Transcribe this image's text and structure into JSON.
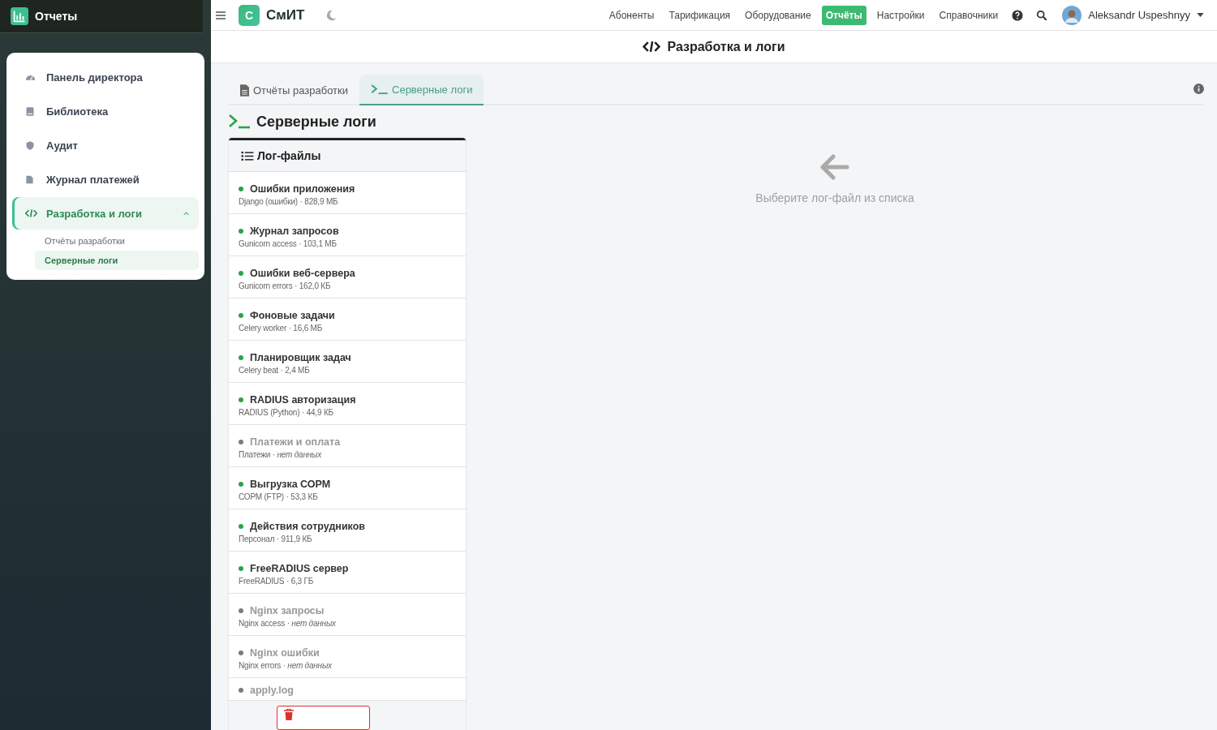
{
  "sidebar": {
    "title": "Отчеты",
    "items": [
      {
        "label": "Панель директора",
        "selected": false
      },
      {
        "label": "Библиотека",
        "selected": false
      },
      {
        "label": "Аудит",
        "selected": false
      },
      {
        "label": "Журнал платежей",
        "selected": false
      },
      {
        "label": "Разработка и логи",
        "selected": true,
        "expanded": true,
        "children": [
          {
            "label": "Отчёты разработки",
            "selected": false
          },
          {
            "label": "Серверные логи",
            "selected": true
          }
        ]
      }
    ]
  },
  "navbar": {
    "logo_letter": "С",
    "brand": "СмИТ",
    "menu": [
      {
        "label": "Абоненты",
        "selected": false
      },
      {
        "label": "Тарификация",
        "selected": false
      },
      {
        "label": "Оборудование",
        "selected": false
      },
      {
        "label": "Отчёты",
        "selected": true
      },
      {
        "label": "Настройки",
        "selected": false
      },
      {
        "label": "Справочники",
        "selected": false
      }
    ],
    "user": "Aleksandr Uspeshnyy"
  },
  "page_title": "Разработка и логи",
  "tabs": [
    {
      "label": "Отчёты разработки",
      "selected": false
    },
    {
      "label": "Серверные логи",
      "selected": true
    }
  ],
  "section_title": "Серверные логи",
  "log_panel": {
    "title": "Лог-файлы",
    "logs": [
      {
        "name": "Ошибки приложения",
        "meta": "Django (ошибки) · 828,9 МБ",
        "active": true
      },
      {
        "name": "Журнал запросов",
        "meta": "Gunicorn access · 103,1 МБ",
        "active": true
      },
      {
        "name": "Ошибки веб-сервера",
        "meta": "Gunicorn errors · 162,0 КБ",
        "active": true
      },
      {
        "name": "Фоновые задачи",
        "meta": "Celery worker · 16,6 МБ",
        "active": true
      },
      {
        "name": "Планировщик задач",
        "meta": "Celery beat · 2,4 МБ",
        "active": true
      },
      {
        "name": "RADIUS авторизация",
        "meta": "RADIUS (Python) · 44,9 КБ",
        "active": true
      },
      {
        "name": "Платежи и оплата",
        "meta": "Платежи · *нет данных*",
        "active": false
      },
      {
        "name": "Выгрузка СОРМ",
        "meta": "СОРМ (FTP) · 53,3 КБ",
        "active": true
      },
      {
        "name": "Действия сотрудников",
        "meta": "Персонал · 911,9 КБ",
        "active": true
      },
      {
        "name": "FreeRADIUS сервер",
        "meta": "FreeRADIUS · 6,3 ГБ",
        "active": true
      },
      {
        "name": "Nginx запросы",
        "meta": "Nginx access · *нет данных*",
        "active": false
      },
      {
        "name": "Nginx ошибки",
        "meta": "Nginx errors · *нет данных*",
        "active": false
      },
      {
        "name": "apply.log",
        "active": false
      }
    ]
  },
  "empty_state": "Выберите лог-файл из списка"
}
